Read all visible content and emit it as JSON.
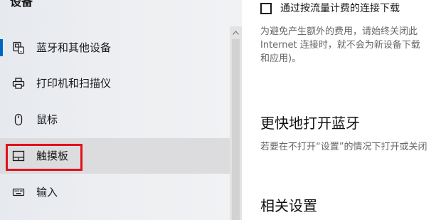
{
  "sidebar": {
    "title": "设备",
    "items": [
      {
        "label": "蓝牙和其他设备",
        "icon": "bluetooth-devices-icon",
        "active": true
      },
      {
        "label": "打印机和扫描仪",
        "icon": "printer-icon"
      },
      {
        "label": "鼠标",
        "icon": "mouse-icon"
      },
      {
        "label": "触摸板",
        "icon": "touchpad-icon",
        "selected": true,
        "highlighted": true
      },
      {
        "label": "输入",
        "icon": "keyboard-icon"
      }
    ],
    "scroll_up_icon": "chevron-up-icon"
  },
  "main": {
    "metered": {
      "checkbox_label": "通过按流量计费的连接下载",
      "checked": false,
      "description_lines": [
        "为避免产生额外的费用，请始终关闭此",
        "Internet 连接时，就不会为新设备下载",
        "和应用)。"
      ]
    },
    "swift_pair": {
      "heading": "更快地打开蓝牙",
      "description": "若要在不打开“设置”的情况下打开或关闭"
    },
    "related": {
      "heading": "相关设置"
    }
  },
  "colors": {
    "accent": "#0067c0",
    "highlight": "#e2101c",
    "selected_bg": "#dcdcde"
  }
}
